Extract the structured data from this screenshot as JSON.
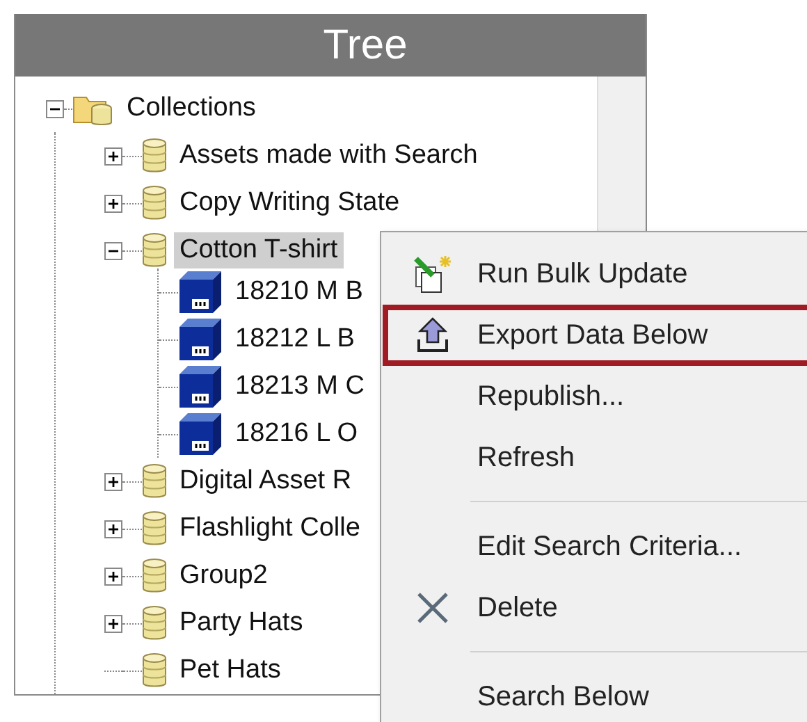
{
  "panel": {
    "title": "Tree"
  },
  "tree": [
    {
      "label": "Collections",
      "kind": "collections",
      "expanded": true,
      "selected": false,
      "children": [
        {
          "label": "Assets made with Search",
          "kind": "database",
          "expanded": false,
          "selected": false
        },
        {
          "label": "Copy Writing State",
          "kind": "database",
          "expanded": false,
          "selected": false
        },
        {
          "label": "Cotton T-shirt",
          "kind": "database",
          "expanded": true,
          "selected": true,
          "children": [
            {
              "label": "18210 M B",
              "kind": "product",
              "selected": false
            },
            {
              "label": "18212 L B",
              "kind": "product",
              "selected": false
            },
            {
              "label": "18213 M C",
              "kind": "product",
              "selected": false
            },
            {
              "label": "18216 L O",
              "kind": "product",
              "selected": false
            }
          ]
        },
        {
          "label": "Digital Asset R",
          "kind": "database",
          "expanded": false,
          "selected": false
        },
        {
          "label": "Flashlight Colle",
          "kind": "database",
          "expanded": false,
          "selected": false
        },
        {
          "label": "Group2",
          "kind": "database",
          "expanded": false,
          "selected": false
        },
        {
          "label": "Party Hats",
          "kind": "database",
          "expanded": false,
          "selected": false
        },
        {
          "label": "Pet Hats",
          "kind": "database",
          "selected": false
        }
      ]
    }
  ],
  "context_menu": [
    {
      "kind": "update",
      "label": "Run Bulk Update",
      "highlighted": false
    },
    {
      "kind": "export",
      "label": "Export Data Below",
      "highlighted": true
    },
    {
      "kind": "plain",
      "label": "Republish...",
      "highlighted": false
    },
    {
      "kind": "plain",
      "label": "Refresh",
      "highlighted": false
    },
    {
      "kind": "separator"
    },
    {
      "kind": "plain",
      "label": "Edit Search Criteria...",
      "highlighted": false
    },
    {
      "kind": "delete",
      "label": "Delete",
      "highlighted": false
    },
    {
      "kind": "separator"
    },
    {
      "kind": "plain",
      "label": "Search Below",
      "highlighted": false
    }
  ]
}
